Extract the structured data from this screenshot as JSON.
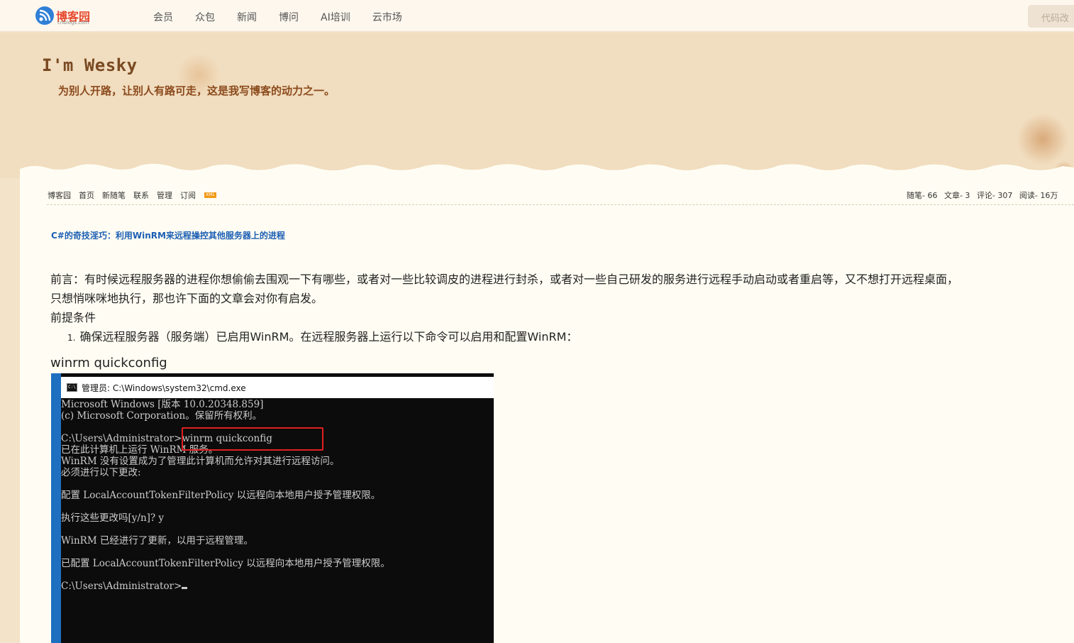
{
  "topnav": {
    "logo_text": "博客园",
    "logo_sub": "cnblogs.com",
    "links": [
      "会员",
      "众包",
      "新闻",
      "博问",
      "AI培训",
      "云市场"
    ],
    "search_placeholder": "代码改"
  },
  "header": {
    "title": "I'm Wesky",
    "subtitle": "为别人开路，让别人有路可走，这是我写博客的动力之一。"
  },
  "subnav": {
    "links": [
      "博客园",
      "首页",
      "新随笔",
      "联系",
      "管理",
      "订阅"
    ],
    "xml_badge": "XML"
  },
  "stats": {
    "posts": "随笔- 66",
    "articles": "文章- 3",
    "comments": "评论- 307",
    "reads": "阅读- 16万"
  },
  "post": {
    "title": "C#的奇技淫巧：利用WinRM来远程操控其他服务器上的进程",
    "intro_line1": "前言：有时候远程服务器的进程你想偷偷去围观一下有哪些，或者对一些比较调皮的进程进行封杀，或者对一些自己研发的服务进行远程手动启动或者重启等，又不想打开远程桌面，",
    "intro_line2": "只想悄咪咪地执行，那也许下面的文章会对你有启发。",
    "prereq": "前提条件",
    "list_item_num": "1.",
    "list_item_1": "确保远程服务器（服务端）已启用WinRM。在远程服务器上运行以下命令可以启用和配置WinRM：",
    "command": "winrm quickconfig"
  },
  "cmd": {
    "title": "管理员: C:\\Windows\\system32\\cmd.exe",
    "icon_label": "C:\\",
    "lines": [
      "Microsoft Windows [版本 10.0.20348.859]",
      "(c) Microsoft Corporation。保留所有权利。",
      "",
      "C:\\Users\\Administrator>winrm quickconfig",
      "已在此计算机上运行 WinRM 服务。",
      "WinRM 没有设置成为了管理此计算机而允许对其进行远程访问。",
      "必须进行以下更改:",
      "",
      "配置 LocalAccountTokenFilterPolicy 以远程向本地用户授予管理权限。",
      "",
      "执行这些更改吗[y/n]? y",
      "",
      "WinRM 已经进行了更新，以用于远程管理。",
      "",
      "已配置 LocalAccountTokenFilterPolicy 以远程向本地用户授予管理权限。",
      "",
      "C:\\Users\\Administrator>"
    ]
  }
}
